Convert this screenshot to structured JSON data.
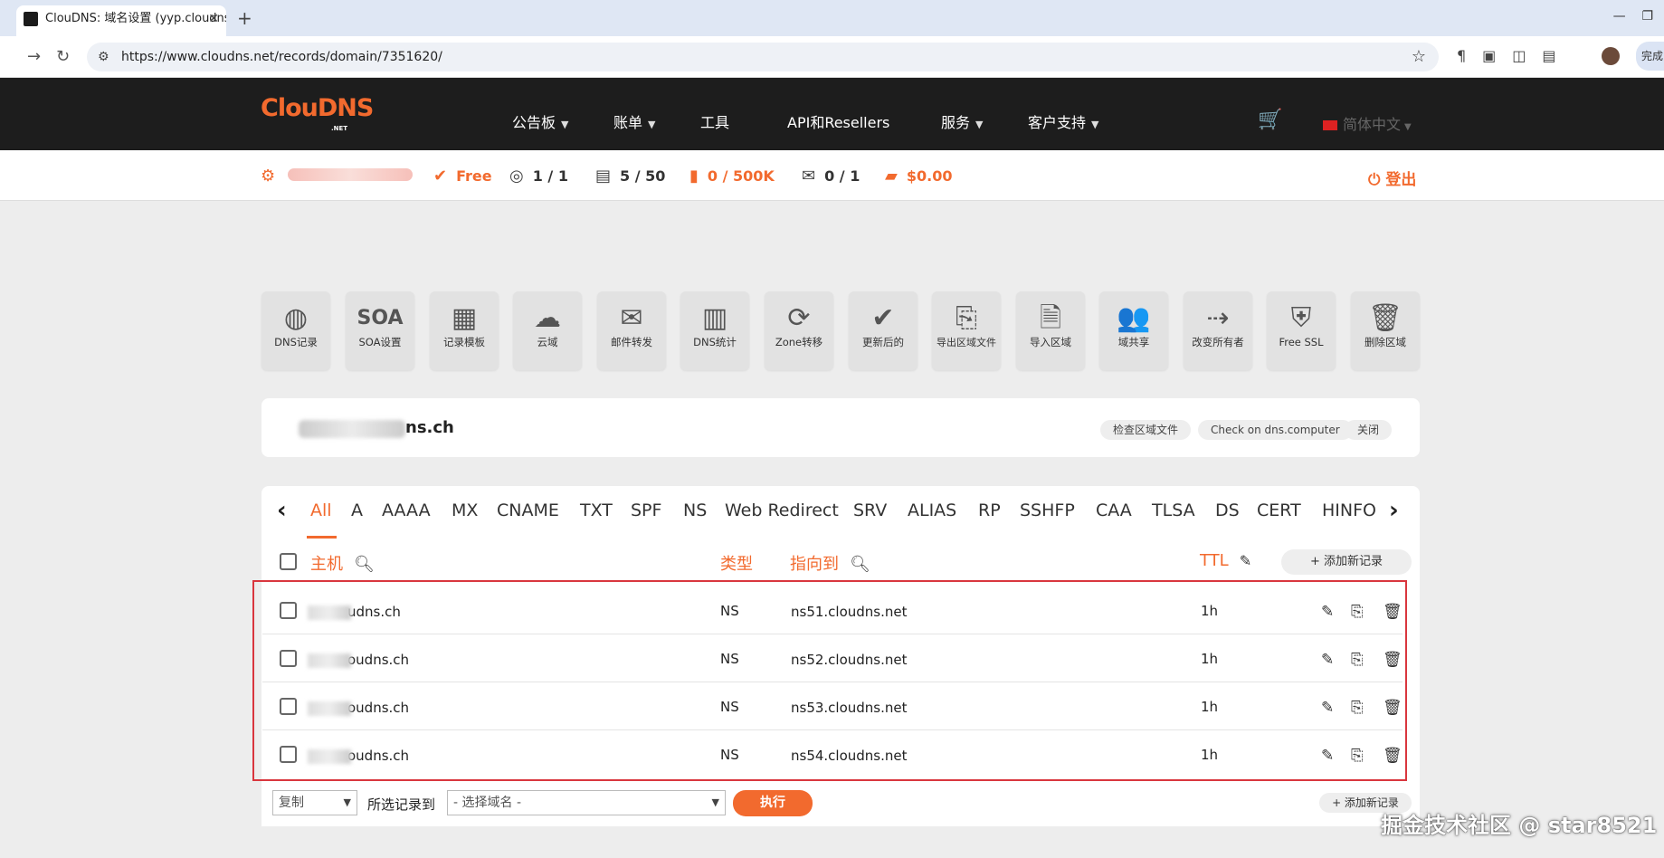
{
  "browser": {
    "tab_title": "ClouDNS: 域名设置 (yyp.cloudns.ch)",
    "url": "https://www.cloudns.net/records/domain/7351620/",
    "side_label": "完成"
  },
  "header": {
    "logo": "ClouDNS",
    "logo_sub": ".NET",
    "menu": [
      {
        "label": "公告板",
        "dropdown": true
      },
      {
        "label": "账单",
        "dropdown": true
      },
      {
        "label": "工具",
        "dropdown": false
      },
      {
        "label": "API和Resellers",
        "dropdown": false
      },
      {
        "label": "服务",
        "dropdown": true
      },
      {
        "label": "客户支持",
        "dropdown": true
      }
    ],
    "language": "简体中文"
  },
  "stats": {
    "plan": "Free",
    "zones": "1 / 1",
    "records": "5 / 50",
    "queries": "0 / 500K",
    "mail_forwards": "0 / 1",
    "balance": "$0.00",
    "logout": "登出"
  },
  "tools": [
    {
      "icon": "globe-icon",
      "label": "DNS记录"
    },
    {
      "icon": "soa-icon",
      "label": "SOA设置"
    },
    {
      "icon": "template-icon",
      "label": "记录模板"
    },
    {
      "icon": "cloud-icon",
      "label": "云域"
    },
    {
      "icon": "mail-forward-icon",
      "label": "邮件转发"
    },
    {
      "icon": "stats-icon",
      "label": "DNS统计"
    },
    {
      "icon": "zone-transfer-icon",
      "label": "Zone转移"
    },
    {
      "icon": "checkmark-icon",
      "label": "更新后的"
    },
    {
      "icon": "export-icon",
      "label": "导出区域文件"
    },
    {
      "icon": "import-icon",
      "label": "导入区域"
    },
    {
      "icon": "users-icon",
      "label": "域共享"
    },
    {
      "icon": "transfer-owner-icon",
      "label": "改变所有者"
    },
    {
      "icon": "ssl-shield-icon",
      "label": "Free SSL"
    },
    {
      "icon": "trash-icon",
      "label": "删除区域"
    }
  ],
  "domain": {
    "name": "ns.ch",
    "actions": [
      "检查区域文件",
      "Check on dns.computer",
      "关闭"
    ]
  },
  "record_types": [
    "All",
    "A",
    "AAAA",
    "MX",
    "CNAME",
    "TXT",
    "SPF",
    "NS",
    "Web Redirect",
    "SRV",
    "ALIAS",
    "RP",
    "SSHFP",
    "CAA",
    "TLSA",
    "DS",
    "CERT",
    "HINFO"
  ],
  "table": {
    "columns": {
      "host": "主机",
      "type": "类型",
      "points_to": "指向到",
      "ttl": "TTL"
    },
    "add_record": "+ 添加新记录",
    "rows": [
      {
        "host": "udns.ch",
        "type": "NS",
        "points_to": "ns51.cloudns.net",
        "ttl": "1h"
      },
      {
        "host": "oudns.ch",
        "type": "NS",
        "points_to": "ns52.cloudns.net",
        "ttl": "1h"
      },
      {
        "host": "oudns.ch",
        "type": "NS",
        "points_to": "ns53.cloudns.net",
        "ttl": "1h"
      },
      {
        "host": "oudns.ch",
        "type": "NS",
        "points_to": "ns54.cloudns.net",
        "ttl": "1h"
      }
    ]
  },
  "footer": {
    "action_select": "复制",
    "selected_to_label": "所选记录到",
    "domain_select_placeholder": "- 选择域名 -",
    "execute": "执行",
    "add_record": "+ 添加新记录"
  },
  "watermark": "掘金技术社区 @ star8521",
  "colors": {
    "accent": "#f26a2e",
    "header_bg": "#1d1d1d",
    "highlight_border": "#d9363e"
  }
}
